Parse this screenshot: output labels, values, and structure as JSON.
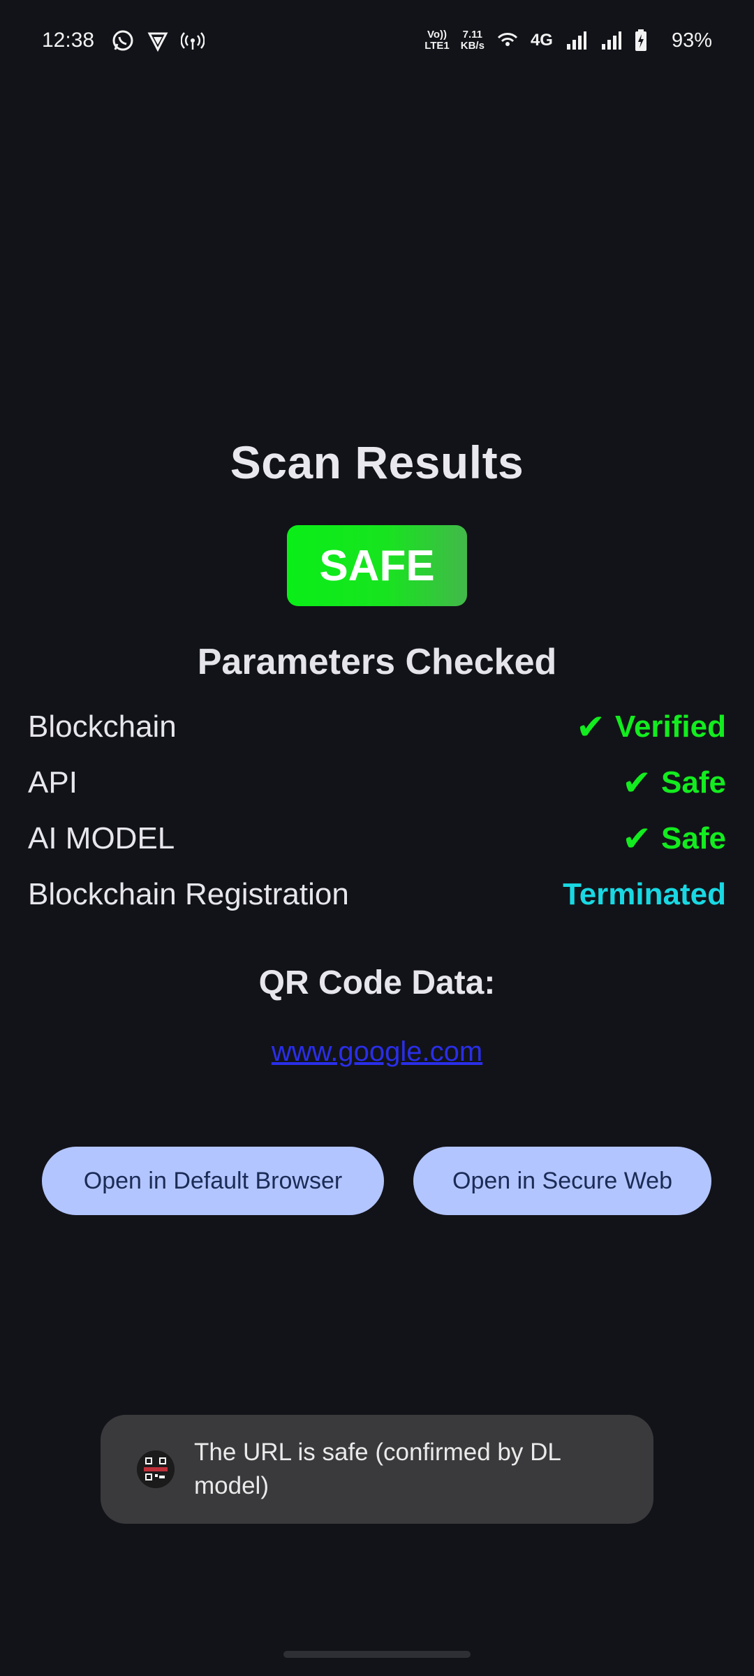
{
  "status_bar": {
    "time": "12:38",
    "volte_top": "Vo))",
    "volte_bottom": "LTE1",
    "speed_value": "7.11",
    "speed_unit": "KB/s",
    "network": "4G",
    "battery": "93%",
    "icons": [
      "whatsapp-icon",
      "vpn-shield-icon",
      "hotspot-icon",
      "wifi-icon",
      "signal-icon",
      "signal-icon-2",
      "battery-charging-icon"
    ]
  },
  "scan": {
    "title": "Scan Results",
    "status": "SAFE",
    "params_heading": "Parameters Checked",
    "params": [
      {
        "label": "Blockchain",
        "check": "✔",
        "value": "Verified"
      },
      {
        "label": "API",
        "check": "✔",
        "value": "Safe"
      },
      {
        "label": "AI MODEL",
        "check": "✔",
        "value": "Safe"
      },
      {
        "label": "Blockchain Registration",
        "value": "Terminated"
      }
    ],
    "qr_heading": "QR Code Data:",
    "qr_value": "www.google.com"
  },
  "actions": {
    "default_browser": "Open in Default Browser",
    "secure_web": "Open in Secure Web"
  },
  "toast": {
    "message": "The URL is safe (confirmed by DL model)"
  },
  "colors": {
    "background": "#121318",
    "safe_green": "#13ec1f",
    "terminated_cyan": "#19d8e3",
    "button_bg": "#b3c5ff",
    "link_blue": "#2a2ee8"
  }
}
